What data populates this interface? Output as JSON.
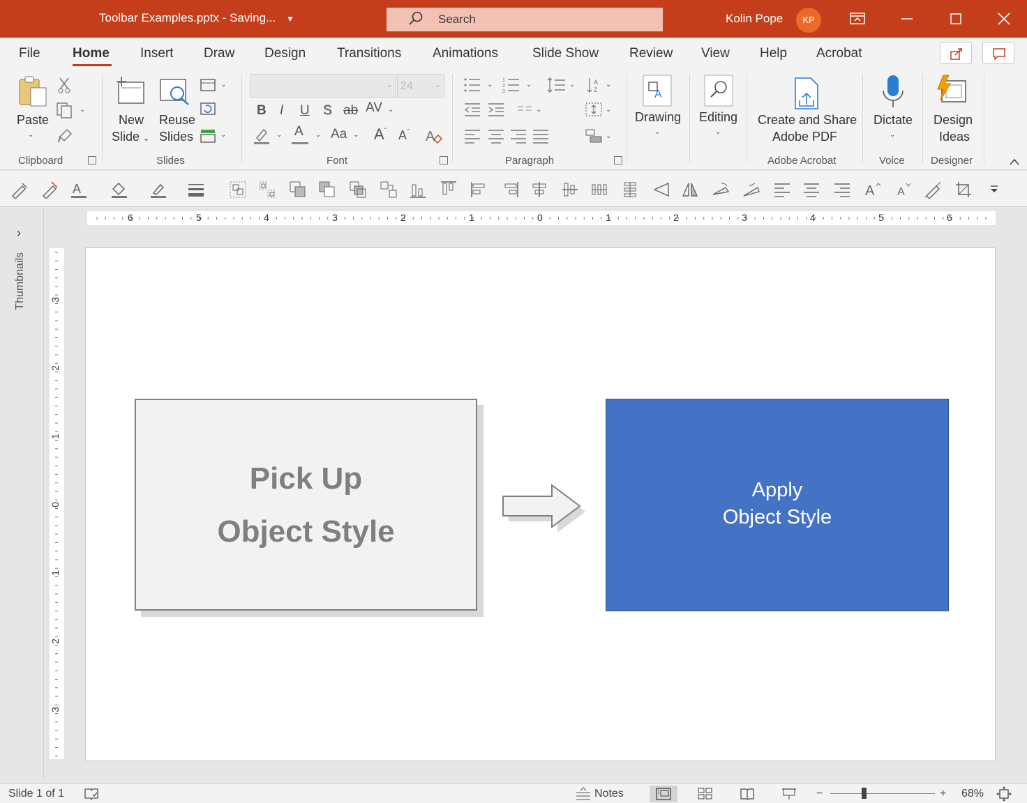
{
  "window": {
    "file_title": "Toolbar Examples.pptx",
    "separator": " - ",
    "save_status": "Saving...",
    "search_placeholder": "Search",
    "user_name": "Kolin Pope",
    "user_initials": "KP"
  },
  "tabs": [
    "File",
    "Home",
    "Insert",
    "Draw",
    "Design",
    "Transitions",
    "Animations",
    "Slide Show",
    "Review",
    "View",
    "Help",
    "Acrobat"
  ],
  "active_tab": "Home",
  "ribbon": {
    "clipboard": {
      "paste": "Paste",
      "label": "Clipboard"
    },
    "slides": {
      "new_slide_1": "New",
      "new_slide_2": "Slide",
      "reuse_1": "Reuse",
      "reuse_2": "Slides",
      "label": "Slides"
    },
    "font": {
      "size": "24",
      "label": "Font",
      "bold": "B",
      "italic": "I",
      "underline": "U",
      "shadow": "S",
      "strike": "ab",
      "spacing": "AV",
      "font_color": "A",
      "change_case": "Aa",
      "grow": "A",
      "shrink": "A"
    },
    "paragraph": {
      "label": "Paragraph"
    },
    "drawing": {
      "label": "Drawing"
    },
    "editing": {
      "label": "Editing"
    },
    "acrobat": {
      "line1": "Create and Share",
      "line2": "Adobe PDF",
      "label": "Adobe Acrobat"
    },
    "voice": {
      "dictate": "Dictate",
      "label": "Voice"
    },
    "designer": {
      "line1": "Design",
      "line2": "Ideas",
      "label": "Designer"
    }
  },
  "side_panel": {
    "label": "Thumbnails"
  },
  "hruler_numbers": [
    "6",
    "5",
    "4",
    "3",
    "2",
    "1",
    "0",
    "1",
    "2",
    "3",
    "4",
    "5",
    "6"
  ],
  "vruler_numbers": [
    "3",
    "2",
    "1",
    "0",
    "1",
    "2",
    "3"
  ],
  "slide": {
    "left_box": {
      "line1": "Pick Up",
      "line2": "Object Style"
    },
    "right_box": {
      "line1": "Apply",
      "line2": "Object Style"
    },
    "accent_color": "#4472c4"
  },
  "status": {
    "slide_indicator": "Slide 1 of 1",
    "notes": "Notes",
    "zoom_minus": "−",
    "zoom_plus": "+",
    "zoom": "68%"
  },
  "colors": {
    "brand": "#c43e1c",
    "ribbon_bg": "#f3f3f3"
  }
}
